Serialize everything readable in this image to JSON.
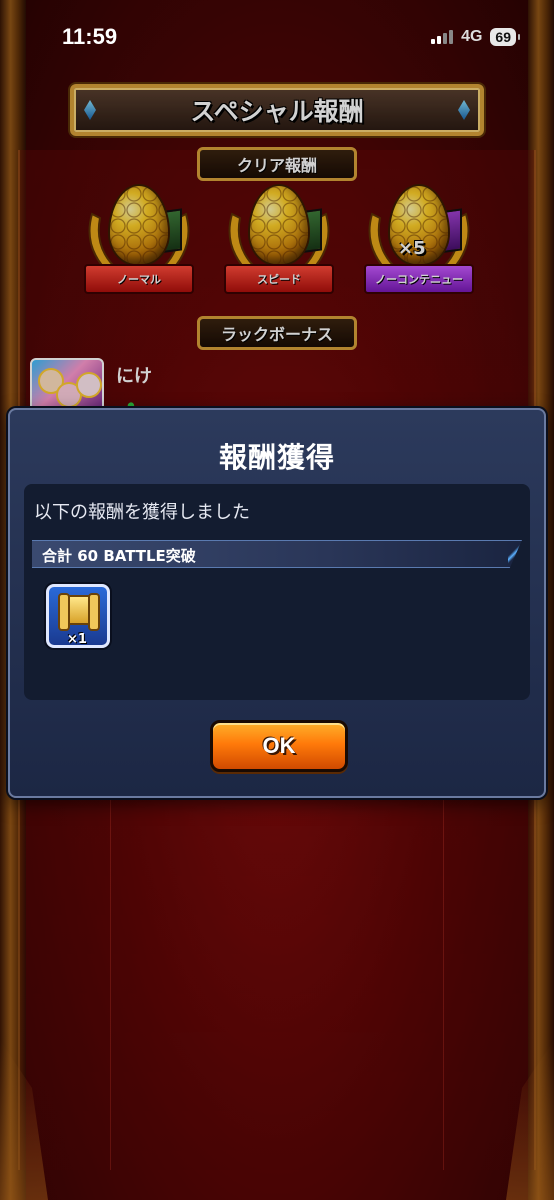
{
  "status_bar": {
    "time": "11:59",
    "network": "4G",
    "battery": "69"
  },
  "header": {
    "title": "スペシャル報酬"
  },
  "clear_rewards": {
    "label": "クリア報酬",
    "items": [
      {
        "label": "ノーマル",
        "count": ""
      },
      {
        "label": "スピード",
        "count": ""
      },
      {
        "label": "ノーコンテニュー",
        "count": "×5"
      }
    ]
  },
  "luck_bonus": {
    "label": "ラックボーナス",
    "player_name": "にけ"
  },
  "dialog": {
    "title": "報酬獲得",
    "message": "以下の報酬を獲得しました",
    "mission": "合計 60 BATTLE突破",
    "item_quantity": "×1",
    "ok_label": "OK"
  },
  "colors": {
    "accent_gold": "#d9a23a",
    "dialog_bg": "#1c2744",
    "ok_orange": "#ff7a0a"
  }
}
